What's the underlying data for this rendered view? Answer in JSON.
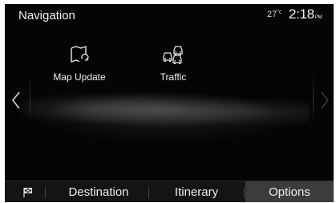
{
  "header": {
    "title": "Navigation",
    "temperature_value": "27",
    "temperature_unit": "°c",
    "time": "2:18",
    "ampm": "PM"
  },
  "tiles": [
    {
      "label": "Map Update",
      "icon": "map-update-icon"
    },
    {
      "label": "Traffic",
      "icon": "traffic-icon"
    }
  ],
  "nav": {
    "prev_icon": "chevron-left-icon",
    "next_icon": "chevron-right-icon"
  },
  "tabs": {
    "flag_icon": "flag-icon",
    "destination": "Destination",
    "itinerary": "Itinerary",
    "options": "Options"
  },
  "colors": {
    "background": "#050505",
    "text": "#f0f0f0",
    "bottom_bar": "#141414",
    "active_tab": "#3c3c3c"
  }
}
